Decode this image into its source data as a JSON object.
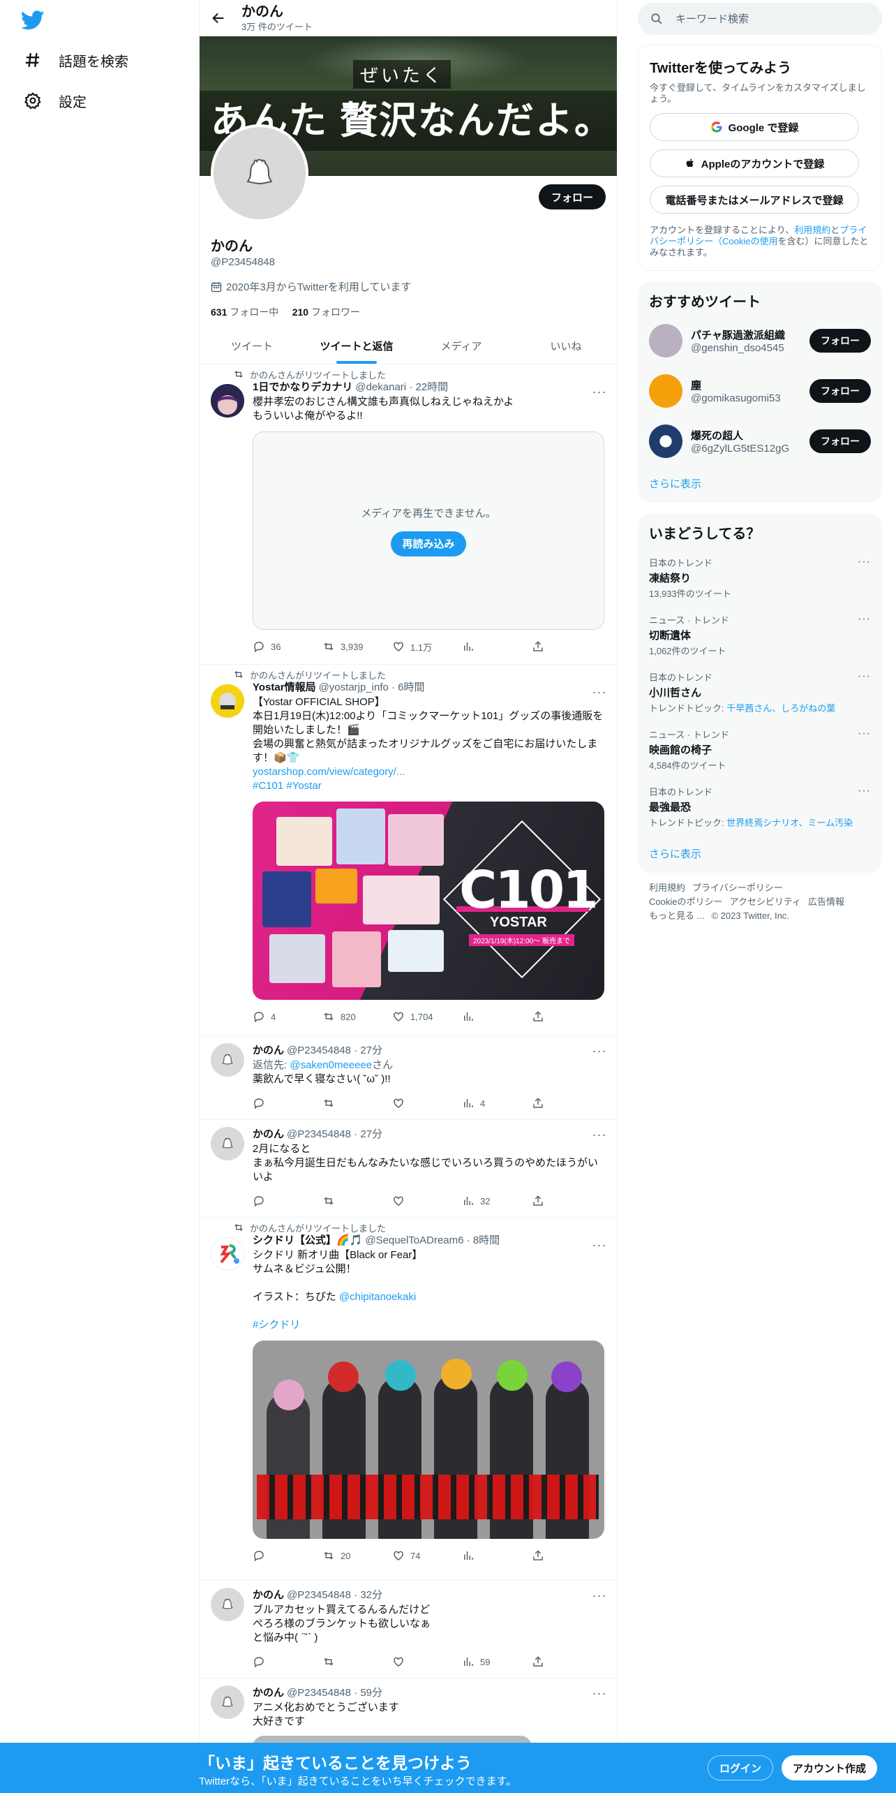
{
  "nav": {
    "explore_label": "話題を検索",
    "settings_label": "設定"
  },
  "profile_header": {
    "name": "かのん",
    "tweet_count": "3万 件のツイート"
  },
  "banner": {
    "ruby": "ぜいたく",
    "caption": "あんた 贅沢なんだよ。"
  },
  "profile": {
    "follow_label": "フォロー",
    "name": "かのん",
    "handle": "@P23454848",
    "joined": "2020年3月からTwitterを利用しています",
    "following_count": "631",
    "following_label": "フォロー中",
    "followers_count": "210",
    "followers_label": "フォロワー"
  },
  "tabs": [
    "ツイート",
    "ツイートと返信",
    "メディア",
    "いいね"
  ],
  "tweets": [
    {
      "retweet_note": "かのんさんがリツイートしました",
      "name": "1日でかなりデカナリ",
      "meta": "@dekanari · 22時間",
      "text": "櫻井孝宏のおじさん構文誰も声真似しねえじゃねえかよ\nもういいよ俺がやるよ!!",
      "media_message": "メディアを再生できません。",
      "reload_label": "再読み込み",
      "reply": "36",
      "retweet": "3,939",
      "like": "1.1万",
      "views": ""
    },
    {
      "retweet_note": "かのんさんがリツイートしました",
      "name": "Yostar情報局",
      "meta": "@yostarjp_info · 6時間",
      "text": "【Yostar OFFICIAL SHOP】\n本日1月19日(木)12:00より「コミックマーケット101」グッズの事後通販を開始いたしました！🎬\n会場の興奮と熱気が詰まったオリジナルグッズをご自宅にお届けいたします！📦👕",
      "link": "yostarshop.com/view/category/...",
      "hashtags": "#C101 #Yostar",
      "image_title": "C101",
      "image_brand": "YOSTAR",
      "image_date": "2023/1/19(木)12:00〜 販売まで",
      "reply": "4",
      "retweet": "820",
      "like": "1,704",
      "views": ""
    },
    {
      "name": "かのん",
      "meta": "@P23454848 · 27分",
      "reply_to_prefix": "返信先: ",
      "reply_to_user": "@saken0meeeee",
      "reply_to_suffix": "さん",
      "text": "薬飲んで早く寝なさい( ˘ω˘ )!!",
      "reply": "",
      "retweet": "",
      "like": "",
      "views": "4"
    },
    {
      "name": "かのん",
      "meta": "@P23454848 · 27分",
      "text": "2月になると\nまぁ私今月誕生日だもんなみたいな感じでいろいろ買うのやめたほうがいいよ",
      "reply": "",
      "retweet": "",
      "like": "",
      "views": "32"
    },
    {
      "retweet_note": "かのんさんがリツイートしました",
      "name": "シクドリ【公式】🌈🎵",
      "meta": "@SequelToADream6 · 8時間",
      "text": "シクドリ 新オリ曲【Black or Fear】\nサムネ＆ビジュ公開！\n\nイラスト：ちぴた ",
      "mention": "@chipitanoekaki",
      "hashtags": "#シクドリ",
      "reply": "",
      "retweet": "20",
      "like": "74",
      "views": ""
    },
    {
      "name": "かのん",
      "meta": "@P23454848 · 32分",
      "text": "ブルアカセット買えてるんるんだけど\nぺろろ様のブランケットも欲しいなぁ\nと悩み中( ˊ˘ˋ )",
      "reply": "",
      "retweet": "",
      "like": "",
      "views": "59"
    },
    {
      "name": "かのん",
      "meta": "@P23454848 · 59分",
      "text": "アニメ化おめでとうございます\n大好きです"
    }
  ],
  "search": {
    "placeholder": "キーワード検索"
  },
  "signup": {
    "title": "Twitterを使ってみよう",
    "subtitle": "今すぐ登録して、タイムラインをカスタマイズしましょう。",
    "google": "Google で登録",
    "apple": "Appleのアカウントで登録",
    "phone": "電話番号またはメールアドレスで登録",
    "terms_1": "アカウントを登録することにより、",
    "terms_link1": "利用規約",
    "terms_2": "と",
    "terms_link2": "プライバシーポリシー（Cookieの使用",
    "terms_3": "を含む）に同意したとみなされます。"
  },
  "recommended": {
    "title": "おすすめツイート",
    "items": [
      {
        "name": "パチャ豚過激派組織",
        "handle": "@genshin_dso4545",
        "button": "フォロー",
        "color": "#b9b1c0"
      },
      {
        "name": "塵",
        "handle": "@gomikasugomi53",
        "button": "フォロー",
        "color": "#f5a00b"
      },
      {
        "name": "爆死の超人",
        "handle": "@6gZylLG5tES12gG",
        "button": "フォロー",
        "color": "#1e3d6e"
      }
    ],
    "show_more": "さらに表示"
  },
  "trends": {
    "title": "いまどうしてる？",
    "items": [
      {
        "category": "日本のトレンド",
        "title": "凍結祭り",
        "extra": "13,933件のツイート"
      },
      {
        "category": "ニュース · トレンド",
        "title": "切断遺体",
        "extra": "1,062件のツイート"
      },
      {
        "category": "日本のトレンド",
        "title": "小川哲さん",
        "extra_prefix": "トレンドトピック: ",
        "extra_link": "千早茜さん、しろがねの葉"
      },
      {
        "category": "ニュース · トレンド",
        "title": "映画館の椅子",
        "extra": "4,584件のツイート"
      },
      {
        "category": "日本のトレンド",
        "title": "最強最恐",
        "extra_prefix": "トレンドトピック: ",
        "extra_link": "世界終焉シナリオ、ミーム汚染"
      }
    ],
    "show_more": "さらに表示"
  },
  "footer": {
    "terms": "利用規約",
    "privacy": "プライバシーポリシー",
    "cookie": "Cookieのポリシー",
    "accessibility": "アクセシビリティ",
    "ads": "広告情報",
    "more": "もっと見る ...",
    "copyright": "© 2023 Twitter, Inc."
  },
  "bottom_bar": {
    "headline": "「いま」起きていることを見つけよう",
    "sub": "Twitterなら、「いま」起きていることをいち早くチェックできます。",
    "login": "ログイン",
    "signup": "アカウント作成"
  },
  "colors": {
    "accent": "#1d9bf0",
    "dark": "#0f1419",
    "muted": "#536471"
  }
}
